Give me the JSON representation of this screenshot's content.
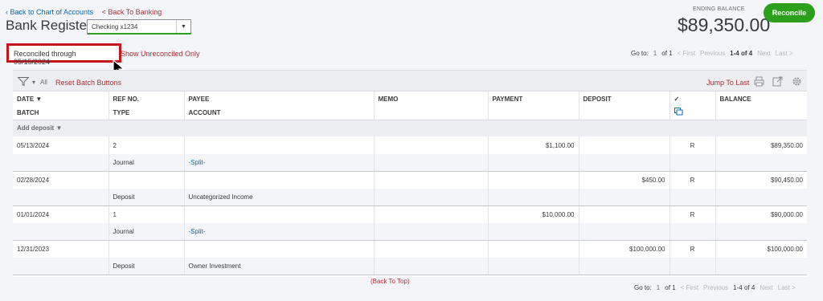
{
  "breadcrumb": {
    "back_to_chart": "Back to Chart of Accounts",
    "back_to_banking": "< Back To Banking"
  },
  "page_title": "Bank Register",
  "account_select": {
    "value": "Checking x1234"
  },
  "ending_balance": {
    "label": "ENDING BALANCE",
    "value": "$89,350.00"
  },
  "reconcile_button": "Reconcile",
  "reconciled_through": "Reconciled through 05/15/2024",
  "show_unreconciled": "Show Unreconciled Only",
  "pager": {
    "goto": "Go to:",
    "page": "1",
    "of": "of 1",
    "first": "< First",
    "previous": "Previous",
    "range": "1-4 of 4",
    "next": "Next",
    "last": "Last >"
  },
  "toolbar": {
    "filter_all": "All",
    "reset_batch": "Reset Batch Buttons",
    "jump_to_last": "Jump To Last"
  },
  "columns": {
    "date": "DATE ▼",
    "batch": "BATCH",
    "ref": "REF NO.",
    "type": "TYPE",
    "payee": "PAYEE",
    "account": "ACCOUNT",
    "memo": "MEMO",
    "payment": "PAYMENT",
    "deposit": "DEPOSIT",
    "reconcile_mark": "✓",
    "balance": "BALANCE"
  },
  "add_deposit": "Add deposit ▼",
  "rows": [
    {
      "date": "05/13/2024",
      "ref": "2",
      "payee": "",
      "memo": "",
      "payment": "$1,100.00",
      "deposit": "",
      "status": "R",
      "balance": "$89,350.00",
      "type": "Journal",
      "account": "-Split-"
    },
    {
      "date": "02/28/2024",
      "ref": "",
      "payee": "",
      "memo": "",
      "payment": "",
      "deposit": "$450.00",
      "status": "R",
      "balance": "$90,450.00",
      "type": "Deposit",
      "account": "Uncategorized Income"
    },
    {
      "date": "01/01/2024",
      "ref": "1",
      "payee": "",
      "memo": "",
      "payment": "$10,000.00",
      "deposit": "",
      "status": "R",
      "balance": "$90,000.00",
      "type": "Journal",
      "account": "-Split-"
    },
    {
      "date": "12/31/2023",
      "ref": "",
      "payee": "",
      "memo": "",
      "payment": "",
      "deposit": "$100,000.00",
      "status": "R",
      "balance": "$100,000.00",
      "type": "Deposit",
      "account": "Owner Investment"
    }
  ],
  "back_to_top": "(Back To Top)",
  "colors": {
    "accent_green": "#2ca01c",
    "link_red": "#a8323a",
    "link_blue": "#0d6aa8",
    "highlight_box": "#c4161c"
  }
}
